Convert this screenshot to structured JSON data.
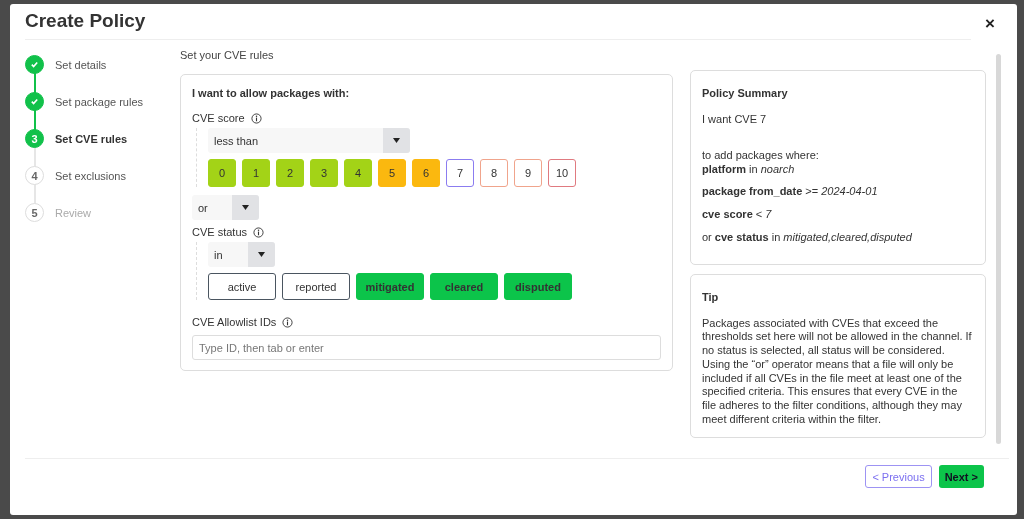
{
  "dialog": {
    "title": "Create Policy",
    "close": "×"
  },
  "steps": [
    {
      "label": "Set details",
      "done": true,
      "selected": false
    },
    {
      "label": "Set package rules",
      "done": true,
      "selected": false
    },
    {
      "number": "3",
      "label": "Set CVE rules",
      "done": false,
      "selected": true
    },
    {
      "number": "4",
      "label": "Set exclusions",
      "done": false,
      "selected": false
    },
    {
      "number": "5",
      "label": "Review",
      "done": false,
      "selected": false
    }
  ],
  "section_title": "Set your CVE rules",
  "rules": {
    "heading": "I want to allow packages with:",
    "cve_score": {
      "label": "CVE score",
      "operator": "less than",
      "scores": [
        {
          "label": "0",
          "selected": true,
          "color": "#a3d317"
        },
        {
          "label": "1",
          "selected": true,
          "color": "#a3d317"
        },
        {
          "label": "2",
          "selected": true,
          "color": "#a3d317"
        },
        {
          "label": "3",
          "selected": true,
          "color": "#a3d317"
        },
        {
          "label": "4",
          "selected": true,
          "color": "#a3d317"
        },
        {
          "label": "5",
          "selected": true,
          "color": "#fbb80f"
        },
        {
          "label": "6",
          "selected": true,
          "color": "#fbb80f"
        },
        {
          "label": "7",
          "selected": false,
          "color": "#8b7cf0"
        },
        {
          "label": "8",
          "selected": false,
          "color": "#f0a48c"
        },
        {
          "label": "9",
          "selected": false,
          "color": "#f0a48c"
        },
        {
          "label": "10",
          "selected": false,
          "color": "#e07a80"
        }
      ]
    },
    "combinator": "or",
    "cve_status": {
      "label": "CVE status",
      "operator": "in",
      "statuses": [
        {
          "label": "active",
          "selected": false
        },
        {
          "label": "reported",
          "selected": false
        },
        {
          "label": "mitigated",
          "selected": true
        },
        {
          "label": "cleared",
          "selected": true
        },
        {
          "label": "disputed",
          "selected": true
        }
      ]
    },
    "allowlist": {
      "label": "CVE Allowlist IDs",
      "placeholder": "Type ID, then tab or enter"
    }
  },
  "summary": {
    "title": "Policy Summary",
    "intro": "I want CVE 7",
    "where_lines": [
      "to add packages where:",
      "**platform** in *noarch*"
    ],
    "conditions": [
      "**package from_date** >= *2024-04-01*",
      "**cve score** < *7*",
      "or **cve status** in *mitigated,cleared,disputed*"
    ]
  },
  "tip": {
    "title": "Tip",
    "text": "Packages associated with CVEs that exceed the thresholds set here will not be allowed in the channel. If no status is selected, all status will be considered. Using the “or” operator means that a file will only be included if all CVEs in the file meet at least one of the specified criteria. This ensures that every CVE in the file adheres to the filter conditions, although they may meet different criteria within the filter."
  },
  "footer": {
    "previous": "< Previous",
    "next": "Next >"
  }
}
